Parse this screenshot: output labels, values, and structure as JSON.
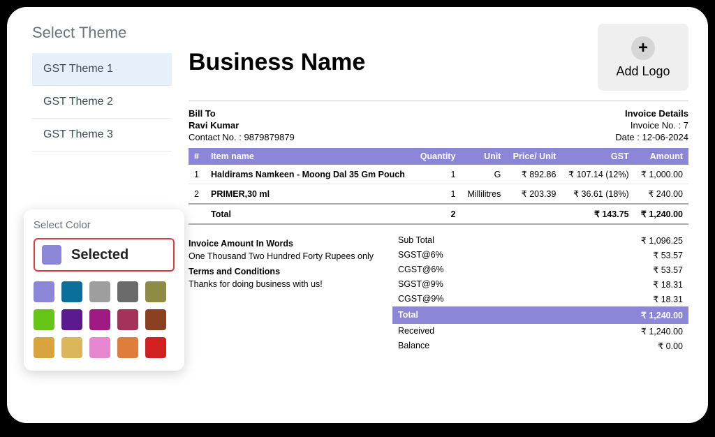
{
  "sidebar": {
    "title": "Select Theme",
    "themes": [
      "GST Theme 1",
      "GST Theme 2",
      "GST Theme 3"
    ],
    "active_index": 0
  },
  "color_picker": {
    "title": "Select Color",
    "selected_label": "Selected",
    "selected_color": "#8b86d8",
    "swatches": [
      "#8b86d8",
      "#0a6f9a",
      "#9e9e9e",
      "#6b6b6b",
      "#8e8b45",
      "#67c419",
      "#5c1a91",
      "#a01a84",
      "#a3335a",
      "#8b4022",
      "#d9a33d",
      "#dcb65a",
      "#e787cf",
      "#df7d3a",
      "#d12020"
    ]
  },
  "invoice": {
    "business_name": "Business Name",
    "add_logo_label": "Add Logo",
    "bill_to_label": "Bill To",
    "customer_name": "Ravi Kumar",
    "contact_label": "Contact No. : 9879879879",
    "details_label": "Invoice Details",
    "invoice_no": "Invoice No. : 7",
    "date": "Date : 12-06-2024",
    "headers": [
      "#",
      "Item name",
      "Quantity",
      "Unit",
      "Price/ Unit",
      "GST",
      "Amount"
    ],
    "rows": [
      {
        "n": "1",
        "name": "Haldirams Namkeen - Moong Dal 35 Gm Pouch",
        "qty": "1",
        "unit": "G",
        "price": "₹ 892.86",
        "gst": "₹ 107.14 (12%)",
        "amount": "₹ 1,000.00"
      },
      {
        "n": "2",
        "name": "PRIMER,30 ml",
        "qty": "1",
        "unit": "Millilitres",
        "price": "₹ 203.39",
        "gst": "₹ 36.61 (18%)",
        "amount": "₹ 240.00"
      }
    ],
    "total_row": {
      "label": "Total",
      "qty": "2",
      "gst": "₹ 143.75",
      "amount": "₹ 1,240.00"
    },
    "words_label": "Invoice Amount In Words",
    "words": "One Thousand Two Hundred Forty Rupees only",
    "terms_label": "Terms and Conditions",
    "terms": "Thanks for doing business with us!",
    "summary": [
      {
        "label": "Sub Total",
        "value": "₹ 1,096.25"
      },
      {
        "label": "SGST@6%",
        "value": "₹ 53.57"
      },
      {
        "label": "CGST@6%",
        "value": "₹ 53.57"
      },
      {
        "label": "SGST@9%",
        "value": "₹ 18.31"
      },
      {
        "label": "CGST@9%",
        "value": "₹ 18.31"
      }
    ],
    "summary_total": {
      "label": "Total",
      "value": "₹ 1,240.00"
    },
    "received": {
      "label": "Received",
      "value": "₹ 1,240.00"
    },
    "balance": {
      "label": "Balance",
      "value": "₹ 0.00"
    }
  }
}
